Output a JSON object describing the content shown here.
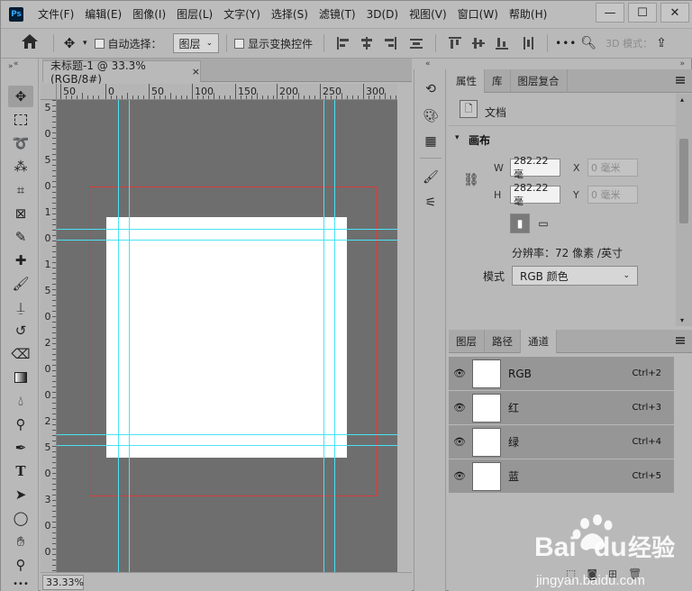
{
  "menubar": {
    "logo": "Ps",
    "items": [
      "文件(F)",
      "编辑(E)",
      "图像(I)",
      "图层(L)",
      "文字(Y)",
      "选择(S)",
      "滤镜(T)",
      "3D(D)",
      "视图(V)",
      "窗口(W)",
      "帮助(H)"
    ],
    "window_buttons": [
      "—",
      "☐",
      "✕"
    ]
  },
  "options": {
    "auto_select_label": "自动选择：",
    "auto_select_value": "图层",
    "show_transform_label": "显示变换控件",
    "mode_3d_label": "3D 模式："
  },
  "document": {
    "tab_title": "未标题-1 @ 33.3%(RGB/8#)",
    "tab_close": "×",
    "zoom": "33.33%"
  },
  "ruler": {
    "h_labels": [
      "50",
      "0",
      "50",
      "100",
      "150",
      "200",
      "250",
      "300"
    ],
    "v_labels": [
      "5",
      "0",
      "5",
      "0",
      "1",
      "0",
      "1",
      "5",
      "0",
      "2",
      "0",
      "0",
      "2",
      "5",
      "0",
      "3",
      "0",
      "0"
    ]
  },
  "properties_panel": {
    "tabs": [
      "属性",
      "库",
      "图层复合"
    ],
    "doc_label": "文档",
    "section": "画布",
    "width_label": "W",
    "width_value": "282.22 毫",
    "height_label": "H",
    "height_value": "282.22 毫",
    "x_label": "X",
    "x_value": "0 毫米",
    "y_label": "Y",
    "y_value": "0 毫米",
    "resolution": "分辨率：72 像素 /英寸",
    "mode_label": "模式",
    "mode_value": "RGB 颜色"
  },
  "channels_panel": {
    "tabs": [
      "图层",
      "路径",
      "通道"
    ],
    "channels": [
      {
        "name": "RGB",
        "shortcut": "Ctrl+2"
      },
      {
        "name": "红",
        "shortcut": "Ctrl+3"
      },
      {
        "name": "绿",
        "shortcut": "Ctrl+4"
      },
      {
        "name": "蓝",
        "shortcut": "Ctrl+5"
      }
    ]
  },
  "watermark": {
    "brand": "Bai",
    "brand2": "du",
    "cn": "经验",
    "url": "jingyan.baidu.com"
  },
  "colors": {
    "guide": "#49e3f5",
    "bleed": "#d83c3c",
    "workspace": "#6e6e6e"
  }
}
